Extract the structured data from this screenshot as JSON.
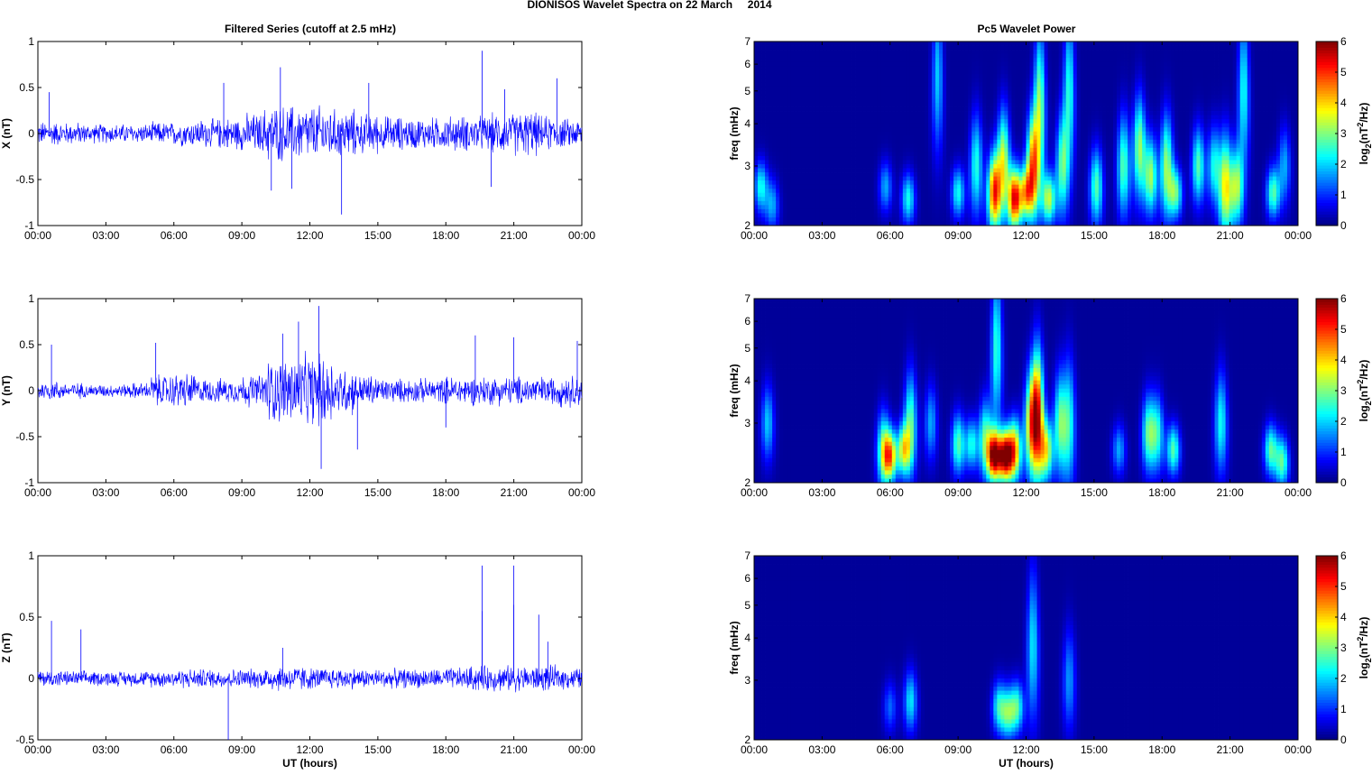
{
  "figure_title": "DIONISOS Wavelet Spectra on 22 March     2014",
  "chart_data": [
    {
      "type": "line",
      "panel": "X",
      "title": "Filtered Series (cutoff at 2.5 mHz)",
      "xlabel": "",
      "ylabel": "X (nT)",
      "xlim": [
        0,
        24
      ],
      "ylim": [
        -1,
        1
      ],
      "xticks": [
        "00:00",
        "03:00",
        "06:00",
        "09:00",
        "12:00",
        "15:00",
        "18:00",
        "21:00",
        "00:00"
      ],
      "yticks": [
        "1",
        "0.5",
        "0",
        "-0.5",
        "-1"
      ],
      "ytick_values": [
        1,
        0.5,
        0,
        -0.5,
        -1
      ],
      "color": "#0000ff",
      "hourly_amplitude_nT": [
        0.15,
        0.14,
        0.12,
        0.12,
        0.12,
        0.14,
        0.16,
        0.18,
        0.2,
        0.25,
        0.35,
        0.35,
        0.35,
        0.3,
        0.25,
        0.22,
        0.2,
        0.2,
        0.22,
        0.22,
        0.25,
        0.28,
        0.22,
        0.18
      ],
      "spikes": [
        [
          0.5,
          0.45
        ],
        [
          8.2,
          0.55
        ],
        [
          10.7,
          0.72
        ],
        [
          11.2,
          -0.6
        ],
        [
          13.4,
          -0.88
        ],
        [
          14.6,
          0.55
        ],
        [
          19.6,
          0.9
        ],
        [
          20.6,
          0.48
        ],
        [
          22.9,
          0.6
        ],
        [
          10.3,
          -0.62
        ],
        [
          20.0,
          -0.58
        ]
      ]
    },
    {
      "type": "line",
      "panel": "Y",
      "xlabel": "",
      "ylabel": "Y (nT)",
      "xlim": [
        0,
        24
      ],
      "ylim": [
        -1,
        1
      ],
      "xticks": [
        "00:00",
        "03:00",
        "06:00",
        "09:00",
        "12:00",
        "15:00",
        "18:00",
        "21:00",
        "00:00"
      ],
      "yticks": [
        "1",
        "0.5",
        "0",
        "-0.5",
        "-1"
      ],
      "ytick_values": [
        1,
        0.5,
        0,
        -0.5,
        -1
      ],
      "color": "#0000ff",
      "hourly_amplitude_nT": [
        0.12,
        0.1,
        0.08,
        0.08,
        0.1,
        0.2,
        0.22,
        0.15,
        0.15,
        0.2,
        0.4,
        0.45,
        0.45,
        0.3,
        0.2,
        0.15,
        0.15,
        0.15,
        0.18,
        0.18,
        0.18,
        0.18,
        0.18,
        0.2
      ],
      "spikes": [
        [
          0.6,
          0.5
        ],
        [
          5.2,
          0.52
        ],
        [
          10.8,
          0.62
        ],
        [
          11.5,
          0.75
        ],
        [
          12.4,
          0.92
        ],
        [
          12.5,
          -0.85
        ],
        [
          14.1,
          -0.64
        ],
        [
          19.3,
          0.6
        ],
        [
          21.0,
          0.58
        ],
        [
          23.8,
          0.54
        ],
        [
          18.0,
          -0.4
        ]
      ]
    },
    {
      "type": "line",
      "panel": "Z",
      "xlabel": "UT (hours)",
      "ylabel": "Z (nT)",
      "xlim": [
        0,
        24
      ],
      "ylim": [
        -0.5,
        1
      ],
      "xticks": [
        "00:00",
        "03:00",
        "06:00",
        "09:00",
        "12:00",
        "15:00",
        "18:00",
        "21:00",
        "00:00"
      ],
      "yticks": [
        "1",
        "0.5",
        "0",
        "-0.5"
      ],
      "ytick_values": [
        1,
        0.5,
        0,
        -0.5
      ],
      "color": "#0000ff",
      "hourly_amplitude_nT": [
        0.08,
        0.07,
        0.07,
        0.07,
        0.07,
        0.08,
        0.09,
        0.09,
        0.09,
        0.09,
        0.12,
        0.12,
        0.1,
        0.1,
        0.09,
        0.09,
        0.09,
        0.09,
        0.1,
        0.12,
        0.12,
        0.12,
        0.12,
        0.1
      ],
      "spikes": [
        [
          0.6,
          0.47
        ],
        [
          1.9,
          0.4
        ],
        [
          8.4,
          -0.5
        ],
        [
          10.8,
          0.25
        ],
        [
          19.6,
          0.92
        ],
        [
          19.6,
          0.55
        ],
        [
          21.0,
          0.92
        ],
        [
          21.0,
          0.6
        ],
        [
          22.1,
          0.52
        ],
        [
          22.5,
          0.3
        ]
      ]
    },
    {
      "type": "heatmap",
      "panel": "X",
      "title": "Pc5 Wavelet Power",
      "xlabel": "",
      "ylabel": "freq (mHz)",
      "xlim": [
        0,
        24
      ],
      "ylim": [
        2,
        7
      ],
      "yscale": "log",
      "xticks": [
        "00:00",
        "03:00",
        "06:00",
        "09:00",
        "12:00",
        "15:00",
        "18:00",
        "21:00",
        "00:00"
      ],
      "yticks": [
        "2",
        "3",
        "4",
        "5",
        "6",
        "7"
      ],
      "ytick_values": [
        2,
        3,
        4,
        5,
        6,
        7
      ],
      "colorbar": {
        "label": "log2(nT2/Hz)",
        "range": [
          0,
          6
        ],
        "ticks": [
          "0",
          "1",
          "2",
          "3",
          "4",
          "5",
          "6"
        ]
      },
      "blobs_hour_freq_power_tallness": [
        [
          0.3,
          2.6,
          2.2,
          1
        ],
        [
          0.8,
          2.3,
          1.6,
          1
        ],
        [
          5.8,
          2.6,
          1.6,
          1
        ],
        [
          6.8,
          2.4,
          2.2,
          1
        ],
        [
          8.1,
          5.5,
          1.8,
          3
        ],
        [
          9.0,
          2.5,
          2.2,
          1
        ],
        [
          9.8,
          3.0,
          2.3,
          2
        ],
        [
          10.6,
          2.5,
          4.8,
          1.5
        ],
        [
          11.0,
          3.1,
          3.3,
          2
        ],
        [
          11.5,
          2.4,
          5.2,
          1.2
        ],
        [
          12.0,
          2.5,
          3.3,
          1
        ],
        [
          12.3,
          3.0,
          4.2,
          2
        ],
        [
          12.6,
          4.5,
          3.0,
          3
        ],
        [
          13.0,
          2.4,
          3.2,
          1
        ],
        [
          13.6,
          3.0,
          2.6,
          2
        ],
        [
          13.9,
          5.0,
          2.3,
          3
        ],
        [
          15.1,
          2.6,
          2.6,
          1.5
        ],
        [
          16.3,
          3.0,
          2.6,
          2
        ],
        [
          17.0,
          3.4,
          3.0,
          2
        ],
        [
          17.5,
          2.8,
          3.0,
          1.5
        ],
        [
          18.2,
          3.0,
          3.0,
          2
        ],
        [
          18.6,
          2.5,
          2.6,
          1
        ],
        [
          19.6,
          3.0,
          2.6,
          1.5
        ],
        [
          20.3,
          3.0,
          2.2,
          1.5
        ],
        [
          20.8,
          2.6,
          3.6,
          2
        ],
        [
          21.3,
          2.6,
          3.0,
          1.5
        ],
        [
          21.6,
          5.0,
          2.2,
          3
        ],
        [
          22.9,
          2.5,
          2.6,
          1
        ],
        [
          23.4,
          3.0,
          1.6,
          1.5
        ]
      ]
    },
    {
      "type": "heatmap",
      "panel": "Y",
      "xlabel": "",
      "ylabel": "freq (mHz)",
      "xlim": [
        0,
        24
      ],
      "ylim": [
        2,
        7
      ],
      "yscale": "log",
      "xticks": [
        "00:00",
        "03:00",
        "06:00",
        "09:00",
        "12:00",
        "15:00",
        "18:00",
        "21:00",
        "00:00"
      ],
      "yticks": [
        "2",
        "3",
        "4",
        "5",
        "6",
        "7"
      ],
      "ytick_values": [
        2,
        3,
        4,
        5,
        6,
        7
      ],
      "colorbar": {
        "label": "log2(nT2/Hz)",
        "range": [
          0,
          6
        ],
        "ticks": [
          "0",
          "1",
          "2",
          "3",
          "4",
          "5",
          "6"
        ]
      },
      "blobs_hour_freq_power_tallness": [
        [
          0.6,
          3.0,
          1.8,
          1.5
        ],
        [
          5.7,
          2.5,
          2.6,
          1.5
        ],
        [
          6.0,
          2.4,
          4.0,
          1
        ],
        [
          6.6,
          2.5,
          3.2,
          1
        ],
        [
          6.9,
          3.0,
          2.6,
          2
        ],
        [
          7.8,
          3.0,
          1.6,
          1.5
        ],
        [
          9.0,
          2.6,
          2.6,
          1.2
        ],
        [
          9.6,
          2.6,
          2.2,
          1
        ],
        [
          10.2,
          2.7,
          2.6,
          1.5
        ],
        [
          10.6,
          2.4,
          5.6,
          1
        ],
        [
          10.7,
          5.0,
          2.4,
          3
        ],
        [
          11.1,
          2.4,
          5.7,
          1
        ],
        [
          11.5,
          2.5,
          4.0,
          1.2
        ],
        [
          12.2,
          3.0,
          3.2,
          2
        ],
        [
          12.5,
          3.2,
          5.0,
          2.5
        ],
        [
          12.9,
          2.5,
          3.2,
          1.2
        ],
        [
          13.5,
          3.0,
          2.6,
          2
        ],
        [
          13.9,
          3.0,
          2.2,
          2.5
        ],
        [
          16.1,
          2.5,
          1.6,
          1
        ],
        [
          17.4,
          2.8,
          2.6,
          1.5
        ],
        [
          17.8,
          2.8,
          2.2,
          1.5
        ],
        [
          18.5,
          2.5,
          2.6,
          1
        ],
        [
          20.6,
          3.0,
          2.2,
          2
        ],
        [
          22.8,
          2.5,
          2.6,
          1
        ],
        [
          23.3,
          2.3,
          2.6,
          1
        ]
      ]
    },
    {
      "type": "heatmap",
      "panel": "Z",
      "xlabel": "UT (hours)",
      "ylabel": "freq (mHz)",
      "xlim": [
        0,
        24
      ],
      "ylim": [
        2,
        7
      ],
      "yscale": "log",
      "xticks": [
        "00:00",
        "03:00",
        "06:00",
        "09:00",
        "12:00",
        "15:00",
        "18:00",
        "21:00",
        "00:00"
      ],
      "yticks": [
        "2",
        "3",
        "4",
        "5",
        "6",
        "7"
      ],
      "ytick_values": [
        2,
        3,
        4,
        5,
        6,
        7
      ],
      "colorbar": {
        "label": "log2(nT2/Hz)",
        "range": [
          0,
          6
        ],
        "ticks": [
          "0",
          "1",
          "2",
          "3",
          "4",
          "5",
          "6"
        ]
      },
      "blobs_hour_freq_power_tallness": [
        [
          6.0,
          2.5,
          1.2,
          1
        ],
        [
          6.9,
          2.6,
          2.0,
          1.2
        ],
        [
          10.8,
          2.5,
          2.2,
          1
        ],
        [
          11.2,
          2.4,
          2.4,
          1
        ],
        [
          11.6,
          2.5,
          2.4,
          1
        ],
        [
          12.3,
          3.8,
          2.0,
          3
        ],
        [
          13.9,
          3.0,
          1.5,
          2
        ]
      ]
    }
  ]
}
